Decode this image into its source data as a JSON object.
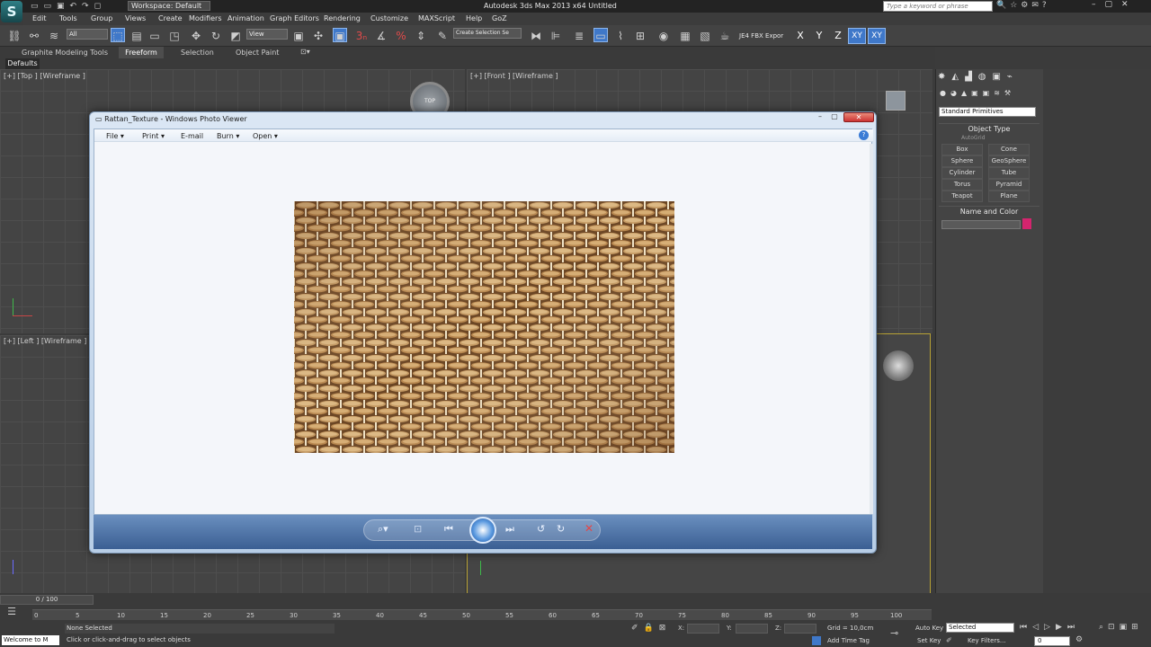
{
  "app": {
    "title": "Autodesk 3ds Max 2013 x64      Untitled",
    "workspace": "Workspace: Default",
    "search_placeholder": "Type a keyword or phrase",
    "logo": "3ds-max-logo"
  },
  "menu": [
    "Edit",
    "Tools",
    "Group",
    "Views",
    "Create",
    "Modifiers",
    "Animation",
    "Graph Editors",
    "Rendering",
    "Customize",
    "MAXScript",
    "Help",
    "GoZ"
  ],
  "toolbar": {
    "filter": "All",
    "view_dropdown": "View",
    "selection_set": "Create Selection Se",
    "fbx": "JE4 FBX Expor",
    "axis": [
      "X",
      "Y",
      "Z",
      "XY",
      "XY"
    ]
  },
  "ribbon": {
    "tabs": [
      "Graphite Modeling Tools",
      "Freeform",
      "Selection",
      "Object Paint"
    ],
    "sub": "Defaults"
  },
  "viewports": {
    "top": "[+] [Top ] [Wireframe ]",
    "front": "[+] [Front ] [Wireframe ]",
    "left": "[+] [Left ] [Wireframe ]",
    "gizmo_top": "TOP"
  },
  "photo_viewer": {
    "title": "Rattan_Texture - Windows Photo Viewer",
    "menu": [
      "File",
      "Print",
      "E-mail",
      "Burn",
      "Open"
    ],
    "image": "rattan-weave-texture"
  },
  "command_panel": {
    "dropdown": "Standard Primitives",
    "object_type": "Object Type",
    "autogrid": "AutoGrid",
    "buttons": [
      "Box",
      "Cone",
      "Sphere",
      "GeoSphere",
      "Cylinder",
      "Tube",
      "Torus",
      "Pyramid",
      "Teapot",
      "Plane"
    ],
    "name_color": "Name and Color",
    "object_color": "#d4246e"
  },
  "timeline": {
    "frame": "0 / 100",
    "ticks": [
      "0",
      "5",
      "10",
      "15",
      "20",
      "25",
      "30",
      "35",
      "40",
      "45",
      "50",
      "55",
      "60",
      "65",
      "70",
      "75",
      "80",
      "85",
      "90",
      "95",
      "100"
    ]
  },
  "status": {
    "welcome": "Welcome to M",
    "none_selected": "None Selected",
    "prompt": "Click or click-and-drag to select objects",
    "x": "X:",
    "y": "Y:",
    "z": "Z:",
    "grid": "Grid = 10,0cm",
    "add_time_tag": "Add Time Tag",
    "auto_key": "Auto Key",
    "set_key": "Set Key",
    "selected": "Selected",
    "key_filters": "Key Filters...",
    "frame": "0"
  }
}
